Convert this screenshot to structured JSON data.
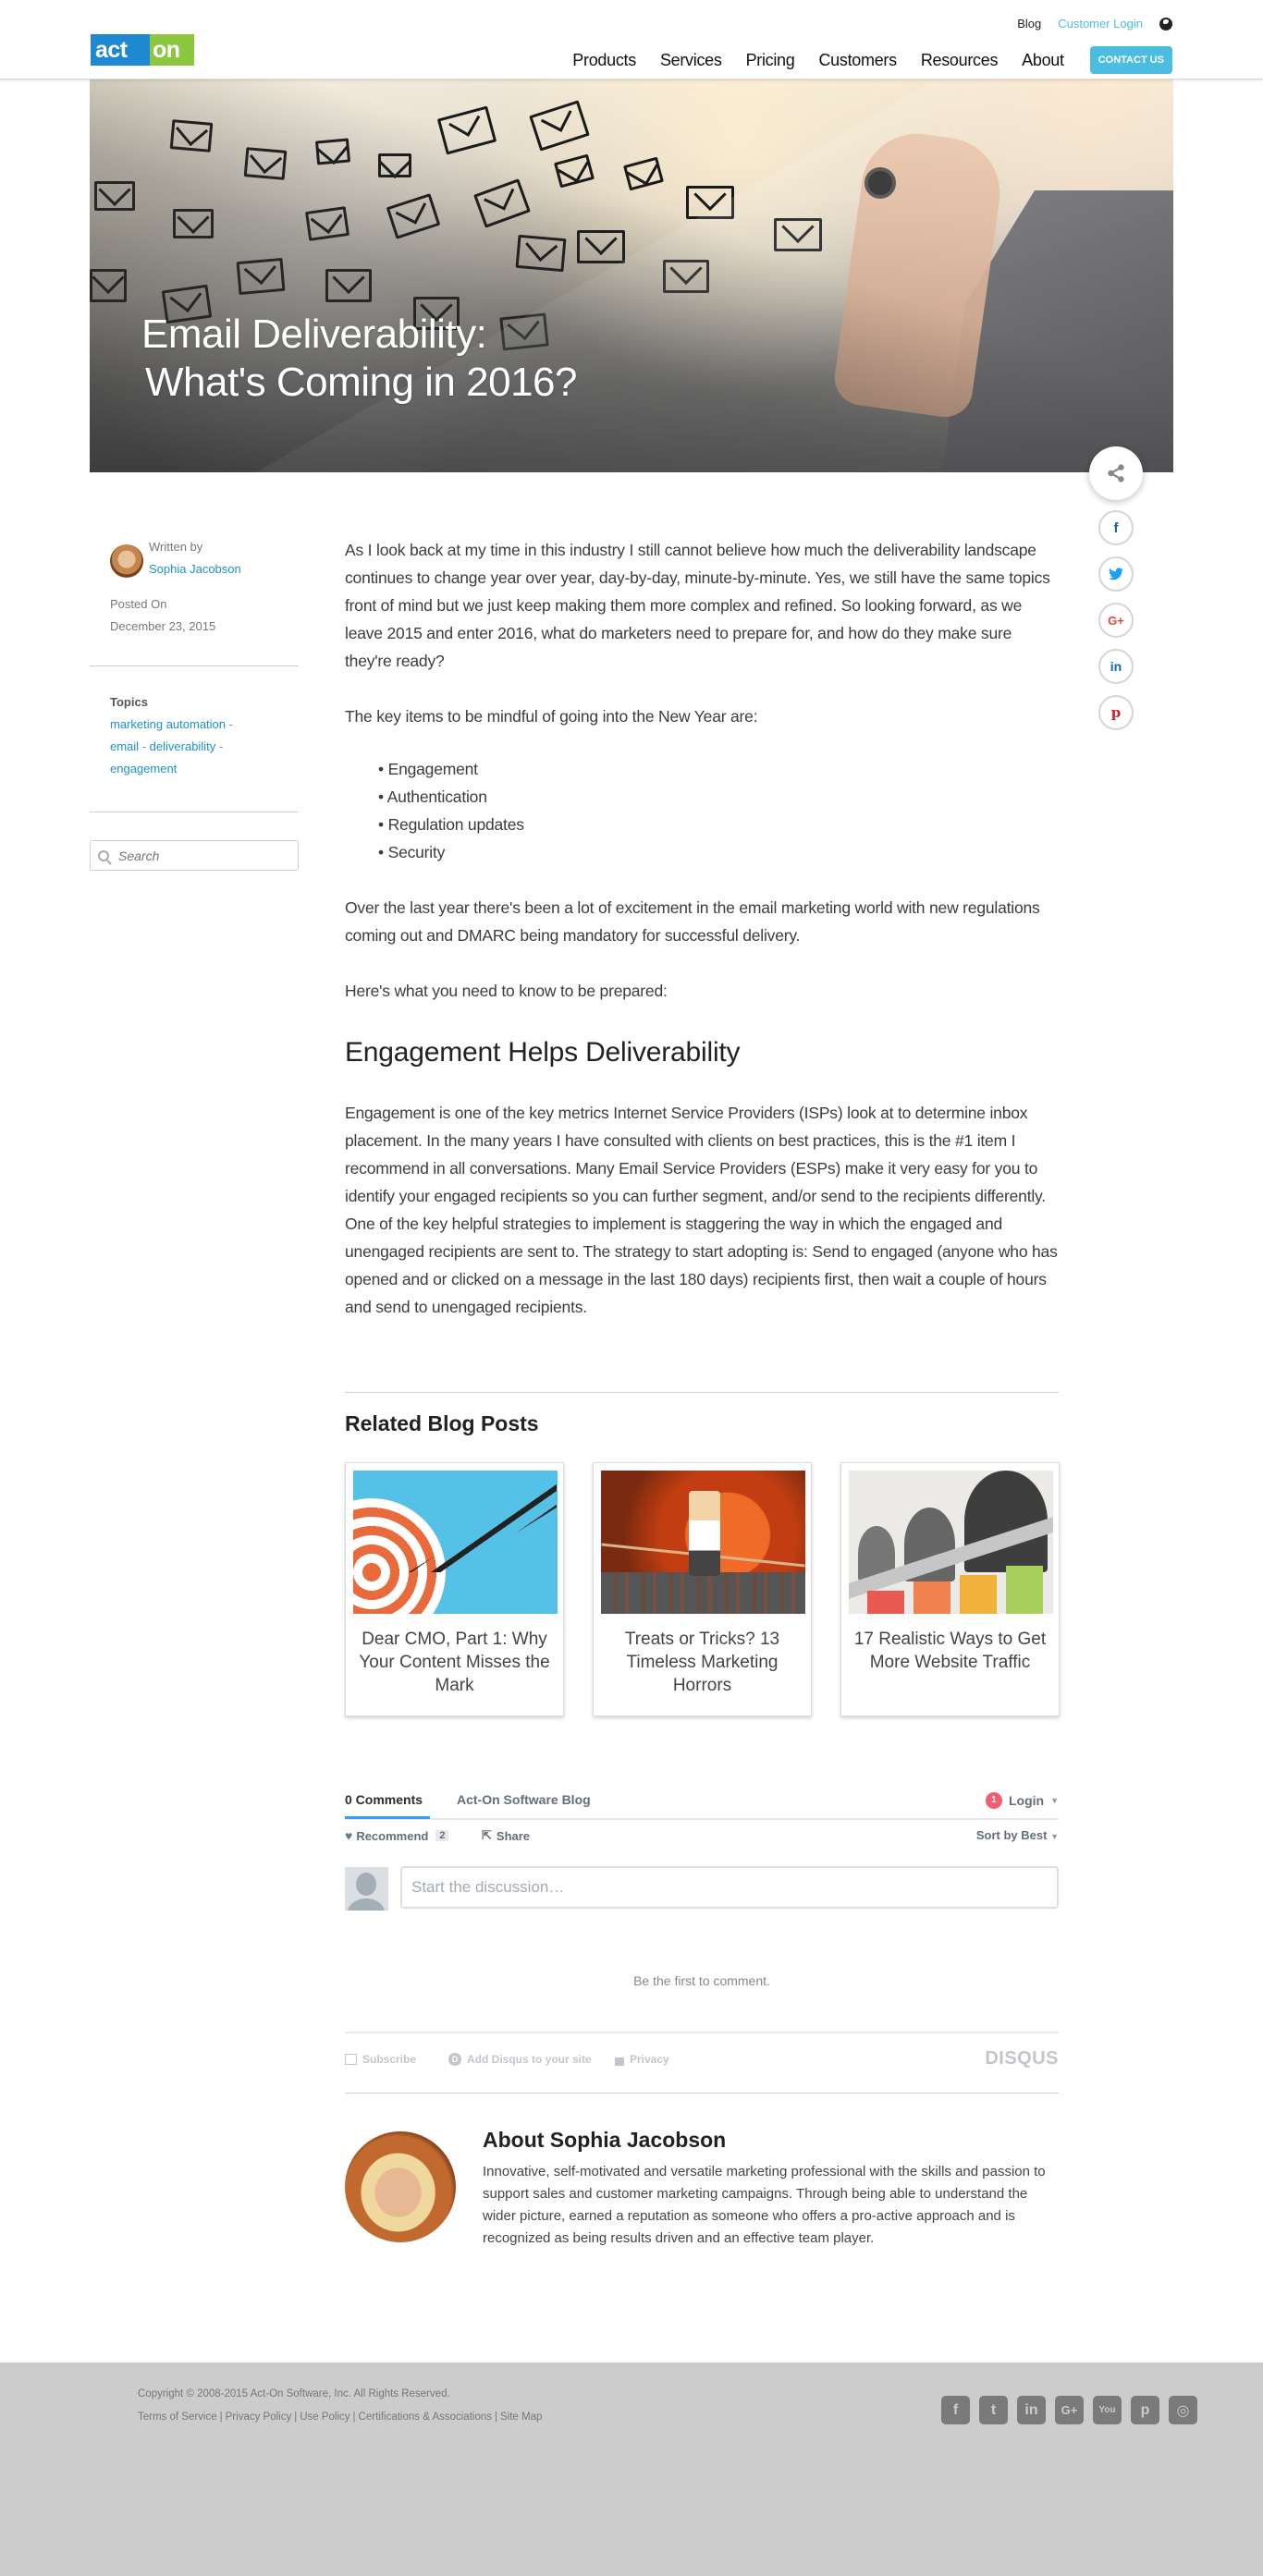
{
  "header": {
    "logo": {
      "left": "act",
      "right": "on"
    },
    "top_links": {
      "blog": "Blog",
      "customer_login": "Customer Login"
    },
    "nav": [
      "Products",
      "Services",
      "Pricing",
      "Customers",
      "Resources",
      "About"
    ],
    "contact_label": "CONTACT US"
  },
  "hero": {
    "title_line1": "Email Deliverability:",
    "title_line2": "What's Coming in 2016?"
  },
  "share": {
    "main_icon": "share-icon",
    "buttons": [
      {
        "name": "facebook",
        "glyph": "f"
      },
      {
        "name": "twitter",
        "glyph": "🐦"
      },
      {
        "name": "google-plus",
        "glyph": "G+"
      },
      {
        "name": "linkedin",
        "glyph": "in"
      },
      {
        "name": "pinterest",
        "glyph": "p"
      }
    ]
  },
  "sidebar": {
    "written_by": "Written by",
    "author": "Sophia Jacobson",
    "posted_on_label": "Posted On",
    "posted_date": "December 23, 2015",
    "topics_label": "Topics",
    "topics": [
      "marketing automation",
      "email",
      "deliverability",
      "engagement"
    ],
    "topic_separator": "-",
    "search_placeholder": "Search"
  },
  "article": {
    "intro": "As I look back at my time in this industry I still cannot believe how much the deliverability landscape continues to change year over year, day-by-day, minute-by-minute. Yes, we still have the same topics front of mind but we just keep making them more complex and refined. So looking forward, as we leave 2015 and enter 2016, what do marketers need to prepare for, and how do they make sure they're ready?",
    "key_items_lead": "The key items to be mindful of going into the New Year are:",
    "key_items": [
      "Engagement",
      "Authentication",
      "Regulation updates",
      "Security"
    ],
    "para2": "Over the last year there's been a lot of excitement in the email marketing world with new regulations coming out and DMARC being mandatory for successful delivery.",
    "para3": "Here's what you need to know to be prepared:",
    "section_heading": "Engagement Helps Deliverability",
    "section_body": "Engagement is one of the key metrics Internet Service Providers (ISPs) look at to determine inbox placement. In the many years I have consulted with clients on best practices, this is the #1 item I recommend in all conversations. Many Email Service Providers (ESPs) make it very easy for you to identify your engaged recipients so you can further segment, and/or send to the recipients differently. One of the key helpful strategies to implement is staggering the way in which the engaged and unengaged recipients are sent to. The strategy to start adopting is: Send to engaged (anyone who has opened and or clicked on a message in the last 180 days) recipients first, then wait a couple of hours and send to unengaged recipients."
  },
  "related": {
    "title": "Related Blog Posts",
    "posts": [
      {
        "title": "Dear CMO, Part 1: Why Your Content Misses the Mark"
      },
      {
        "title": "Treats or Tricks? 13 Timeless Marketing Horrors"
      },
      {
        "title": "17 Realistic Ways to Get More Website Traffic"
      }
    ]
  },
  "comments": {
    "tab_count": "0 Comments",
    "tab_site": "Act-On Software Blog",
    "notification_count": "1",
    "login": "Login",
    "recommend": "Recommend",
    "recommend_count": "2",
    "share": "Share",
    "sort": "Sort by Best",
    "input_placeholder": "Start the discussion…",
    "empty_message": "Be the first to comment.",
    "footer_subscribe": "Subscribe",
    "footer_add": "Add Disqus to your site",
    "footer_privacy": "Privacy",
    "brand": "DISQUS"
  },
  "about": {
    "title": "About Sophia Jacobson",
    "bio": "Innovative, self-motivated and versatile marketing professional with the skills and passion to support sales and customer marketing campaigns. Through being able to understand the wider picture, earned a reputation as someone who offers a pro-active approach and is recognized as being results driven and an effective team player."
  },
  "footer": {
    "copyright": "Copyright © 2008-2015 Act-On Software, Inc. All Rights Reserved.",
    "links": [
      "Terms of Service",
      "Privacy Policy",
      "Use Policy",
      "Certifications & Associations",
      "Site Map"
    ],
    "social": [
      {
        "name": "facebook",
        "glyph": "f"
      },
      {
        "name": "twitter",
        "glyph": "t"
      },
      {
        "name": "linkedin",
        "glyph": "in"
      },
      {
        "name": "google-plus",
        "glyph": "G+"
      },
      {
        "name": "youtube",
        "glyph": "You"
      },
      {
        "name": "pinterest",
        "glyph": "p"
      },
      {
        "name": "instagram",
        "glyph": "◎"
      }
    ]
  },
  "colors": {
    "accent": "#4bbde0",
    "link": "#1e90c9",
    "logo_blue": "#1e88d0",
    "logo_green": "#8dc63f",
    "footer_bg": "#cccccc"
  }
}
